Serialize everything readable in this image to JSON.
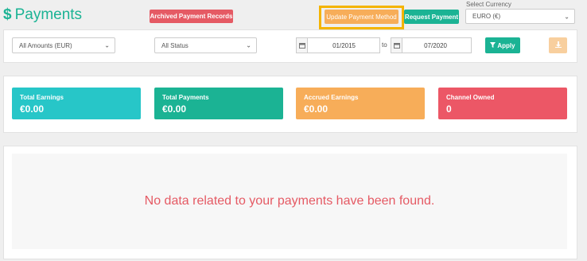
{
  "header": {
    "title_icon": "$",
    "title": "Payments",
    "archived_label": "Archived Payment Records",
    "update_label": "Update Payment Method",
    "request_label": "Request Payment",
    "currency_label": "Select Currency",
    "currency_value": "EURO (€)"
  },
  "filters": {
    "amount_value": "All Amounts (EUR)",
    "status_value": "All Status",
    "date_from": "01/2015",
    "to_label": "to",
    "date_to": "07/2020",
    "apply_label": "Apply"
  },
  "cards": [
    {
      "label": "Total Earnings",
      "value": "€0.00"
    },
    {
      "label": "Total Payments",
      "value": "€0.00"
    },
    {
      "label": "Accrued Earnings",
      "value": "€0.00"
    },
    {
      "label": "Channel Owned",
      "value": "0"
    }
  ],
  "empty_message": "No data related to your payments have been found.",
  "colors": {
    "teal": "#1bb394",
    "cyan": "#27c6c8",
    "orange": "#f7ad59",
    "red": "#ec5766",
    "highlight": "#f4b400"
  }
}
